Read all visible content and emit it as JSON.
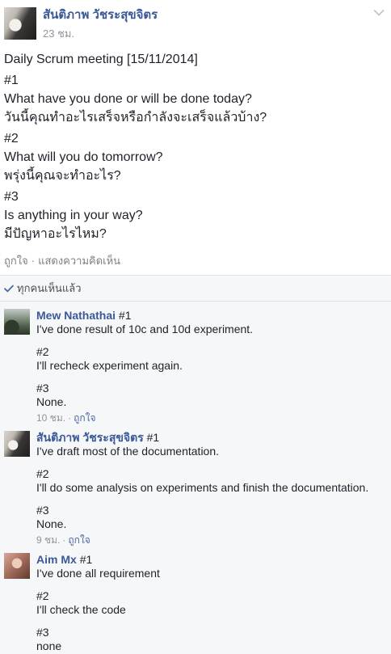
{
  "post": {
    "author": "สันติภาพ วัชระสุขจิตร",
    "time": "23 ชม.",
    "menu_icon": "chevron-down-icon",
    "body": [
      [
        "Daily Scrum meeting [15/11/2014]"
      ],
      [
        "#1",
        "What have you done or will be done today?",
        "วันนี้คุณทำอะไรเสร็จหรือกำลังจะเสร็จแล้วบ้าง?"
      ],
      [
        "#2",
        "What will you do tomorrow?",
        "พรุ่งนี้คุณจะทำอะไร?"
      ],
      [
        "#3",
        "Is anything in your way?",
        "มีปัญหาอะไรไหม?"
      ]
    ],
    "actions": {
      "like": "ถูกใจ",
      "separator": "·",
      "comment": "แสดงความคิดเห็น"
    }
  },
  "seen": {
    "icon": "check-icon",
    "label": "ทุกคนเห็นแล้ว"
  },
  "comments": [
    {
      "author": "Mew Nathathai",
      "paragraphs": [
        [
          "#1",
          "I've done result of 10c and 10d experiment."
        ],
        [
          "#2",
          "I'll recheck experiment again."
        ],
        [
          "#3",
          "None."
        ]
      ],
      "time": "10 ชม.",
      "separator": "·",
      "like": "ถูกใจ"
    },
    {
      "author": "สันติภาพ วัชระสุขจิตร",
      "paragraphs": [
        [
          "#1",
          "I've draft most of the documentation."
        ],
        [
          "#2",
          "I'll do some analysis on experiments and finish the documentation."
        ],
        [
          "#3",
          "None."
        ]
      ],
      "time": "9 ชม.",
      "separator": "·",
      "like": "ถูกใจ"
    },
    {
      "author": "Aim Mx",
      "paragraphs": [
        [
          "#1",
          "I've done all requirement"
        ],
        [
          "#2",
          "I'll check the code"
        ],
        [
          "#3",
          "none"
        ]
      ]
    }
  ],
  "colors": {
    "link_blue": "#3b5998",
    "text": "#1d2129",
    "muted": "#90949c",
    "action_gray": "#7f7f7f",
    "action_blue": "#4b67a1",
    "comment_bg": "#f6f7f9"
  }
}
